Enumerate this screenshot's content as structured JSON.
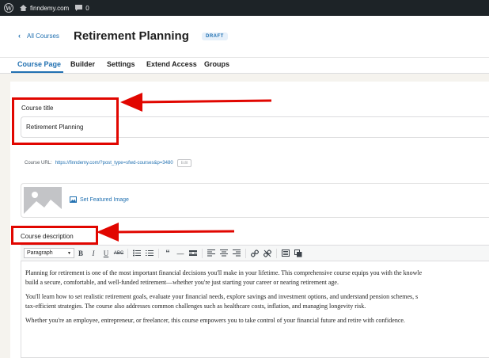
{
  "adminbar": {
    "site_name": "finndemy.com",
    "comment_count": "0"
  },
  "header": {
    "back_label": "All Courses",
    "title": "Retirement Planning",
    "status_badge": "DRAFT"
  },
  "tabs": [
    {
      "label": "Course Page",
      "active": true
    },
    {
      "label": "Builder",
      "active": false
    },
    {
      "label": "Settings",
      "active": false
    },
    {
      "label": "Extend Access",
      "active": false
    },
    {
      "label": "Groups",
      "active": false
    }
  ],
  "course_title": {
    "label": "Course title",
    "value": "Retirement Planning"
  },
  "course_url": {
    "label": "Course URL:",
    "url": "https://finndemy.com/?post_type=sfwd-courses&p=3480",
    "edit_label": "Edit"
  },
  "featured_image": {
    "link_label": "Set Featured Image"
  },
  "course_description": {
    "label": "Course description",
    "format_select": "Paragraph",
    "paragraphs": [
      [
        "Planning for retirement is one of the most important financial decisions you'll make in your lifetime. This comprehensive course equips you with the knowle",
        "build a secure, comfortable, and well-funded retirement—whether you're just starting your career or nearing retirement age."
      ],
      [
        "You'll learn how to set realistic retirement goals, evaluate your financial needs, explore savings and investment options, and understand pension schemes, s",
        "tax-efficient strategies. The course also addresses common challenges such as healthcare costs, inflation, and managing longevity risk."
      ],
      [
        "Whether you're an employee, entrepreneur, or freelancer, this course empowers you to take control of your financial future and retire with confidence."
      ]
    ]
  },
  "colors": {
    "accent": "#2271b1",
    "annotation_red": "#e10600",
    "adminbar": "#1d2327"
  },
  "icons": [
    "wordpress-icon",
    "home-icon",
    "comment-icon",
    "chevron-left-icon",
    "image-icon"
  ]
}
